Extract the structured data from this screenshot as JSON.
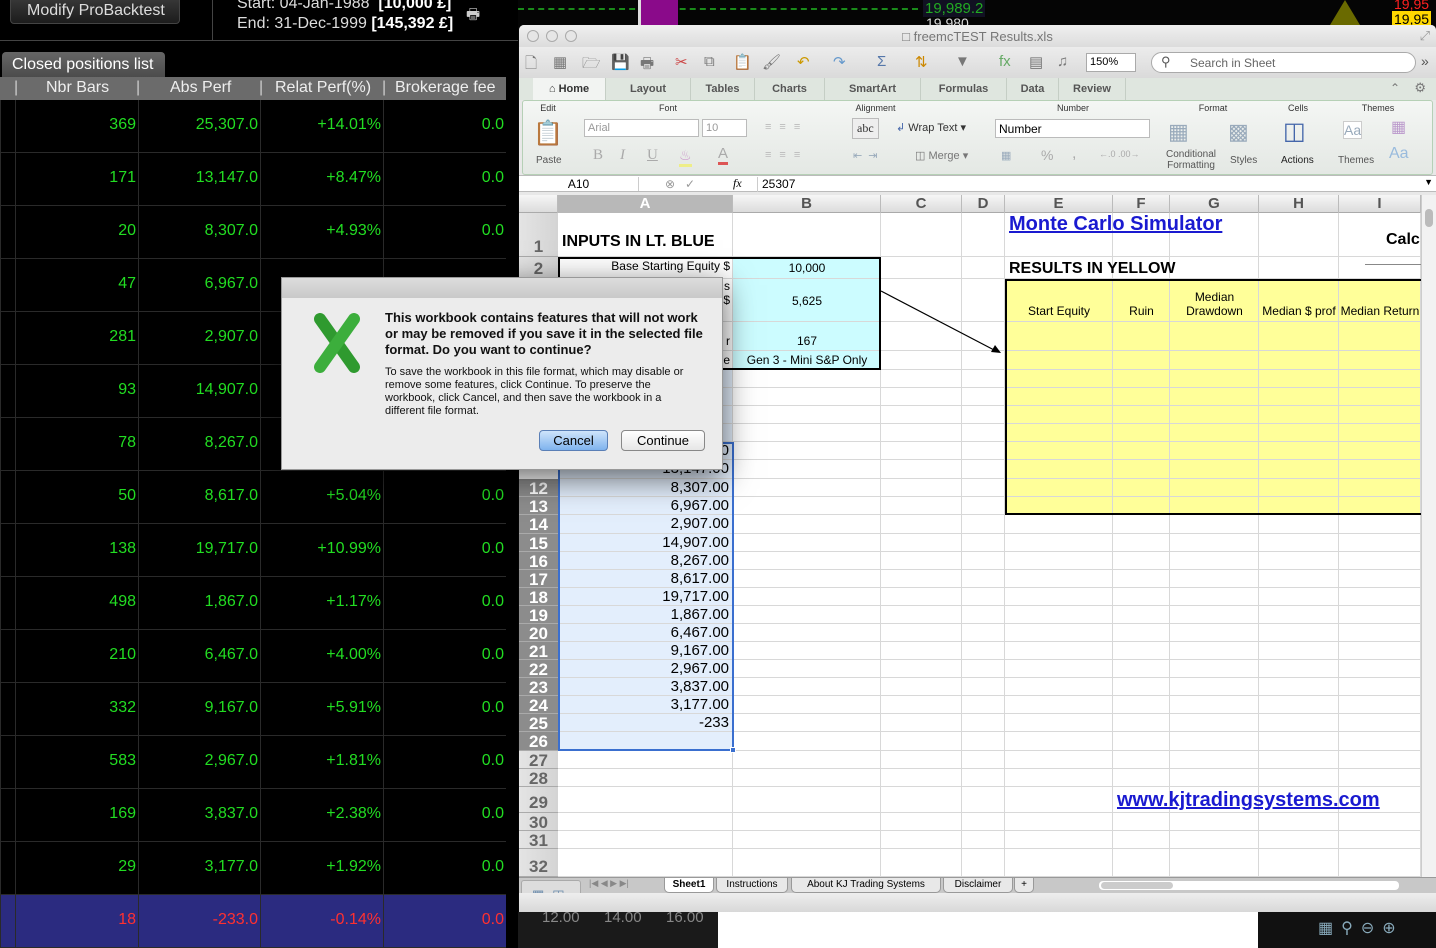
{
  "backtest": {
    "modify_label": "Modify ProBacktest",
    "start_line": "Start: 04-Jan-1988",
    "start_value": "[10,000 £]",
    "end_line": "End:  31-Dec-1999",
    "end_value": "[145,392 £]",
    "tab_label": "Closed positions list",
    "columns": [
      "Nbr Bars",
      "Abs Perf",
      "Relat Perf(%)",
      "Brokerage fee"
    ],
    "rows": [
      [
        "369",
        "25,307.0",
        "+14.01%",
        "0.0"
      ],
      [
        "171",
        "13,147.0",
        "+8.47%",
        "0.0"
      ],
      [
        "20",
        "8,307.0",
        "+4.93%",
        "0.0"
      ],
      [
        "47",
        "6,967.0",
        "",
        ""
      ],
      [
        "281",
        "2,907.0",
        "",
        ""
      ],
      [
        "93",
        "14,907.0",
        "",
        ""
      ],
      [
        "78",
        "8,267.0",
        "",
        ""
      ],
      [
        "50",
        "8,617.0",
        "+5.04%",
        "0.0"
      ],
      [
        "138",
        "19,717.0",
        "+10.99%",
        "0.0"
      ],
      [
        "498",
        "1,867.0",
        "+1.17%",
        "0.0"
      ],
      [
        "210",
        "6,467.0",
        "+4.00%",
        "0.0"
      ],
      [
        "332",
        "9,167.0",
        "+5.91%",
        "0.0"
      ],
      [
        "583",
        "2,967.0",
        "+1.81%",
        "0.0"
      ],
      [
        "169",
        "3,837.0",
        "+2.38%",
        "0.0"
      ],
      [
        "29",
        "3,177.0",
        "+1.92%",
        "0.0"
      ],
      [
        "18",
        "-233.0",
        "-0.14%",
        "0.0"
      ]
    ]
  },
  "chart": {
    "price1": "19,989.2",
    "price2": "19,980",
    "price3": "19,95",
    "price4": "19,95",
    "time_labels": [
      "12.00",
      "14.00",
      "16.00"
    ]
  },
  "excel": {
    "title": "freemcTEST Results.xls",
    "zoom": "150%",
    "search_placeholder": "Search in Sheet",
    "tabs": [
      "Home",
      "Layout",
      "Tables",
      "Charts",
      "SmartArt",
      "Formulas",
      "Data",
      "Review"
    ],
    "active_tab": "Home",
    "groups": [
      "Edit",
      "Font",
      "Alignment",
      "Number",
      "Format",
      "Cells",
      "Themes"
    ],
    "paste": "Paste",
    "font_name": "Arial",
    "font_size": "10",
    "bold": "B",
    "italic": "I",
    "underline": "U",
    "font_color": "A",
    "abc": "abc",
    "wrap_text": "Wrap Text",
    "merge": "Merge",
    "number_format": "Number",
    "percent": "%",
    "comma": ",",
    "conditional": "Conditional Formatting",
    "styles": "Styles",
    "actions": "Actions",
    "themes": "Themes",
    "aa": "Aa",
    "name_box": "A10",
    "fx": "fx",
    "formula": "25307",
    "column_headers": [
      "A",
      "B",
      "C",
      "D",
      "E",
      "F",
      "G",
      "H",
      "I"
    ],
    "row_numbers": [
      "1",
      "2",
      "12",
      "13",
      "14",
      "15",
      "16",
      "17",
      "18",
      "19",
      "20",
      "21",
      "22",
      "23",
      "24",
      "25",
      "26",
      "27",
      "28",
      "29",
      "30",
      "31",
      "32"
    ],
    "cells": {
      "A1": "INPUTS IN LT. BLUE",
      "A2": "Base Starting Equity $",
      "A3a": "s",
      "A3b": "$",
      "A4": "r",
      "A5": "e",
      "B2": "10,000",
      "B3": "5,625",
      "B4": "167",
      "B5": "Gen 3 - Mini S&P Only",
      "E1": "Monte Carlo Simulator",
      "I1": "Calc",
      "E2": "RESULTS IN YELLOW",
      "E3": "Start Equity",
      "F3": "Ruin",
      "G3": "Median Drawdown",
      "H3": "Median $ prof",
      "I3": "Median Return",
      "F29": "www.kjtradingsystems.com"
    },
    "column_a_values": [
      "25,307.00",
      "13,147.00",
      "8,307.00",
      "6,967.00",
      "2,907.00",
      "14,907.00",
      "8,267.00",
      "8,617.00",
      "19,717.00",
      "1,867.00",
      "6,467.00",
      "9,167.00",
      "2,967.00",
      "3,837.00",
      "3,177.00",
      "-233"
    ],
    "sheet_tabs": [
      "Sheet1",
      "Instructions",
      "About KJ Trading Systems",
      "Disclaimer",
      "+"
    ],
    "active_sheet": "Sheet1",
    "colors": {
      "input_blue": "#ccfcff",
      "result_yellow": "#ffff99",
      "selection": "#e3eefc",
      "link": "#1a1ad0"
    }
  },
  "dialog": {
    "headline": "This workbook contains features that will not work or may be removed if you save it in the selected file format. Do you want to continue?",
    "body": "To save the workbook in this file format, which may disable or remove some features, click Continue. To preserve the workbook, click Cancel, and then save the workbook in a different file format.",
    "cancel": "Cancel",
    "continue": "Continue"
  }
}
